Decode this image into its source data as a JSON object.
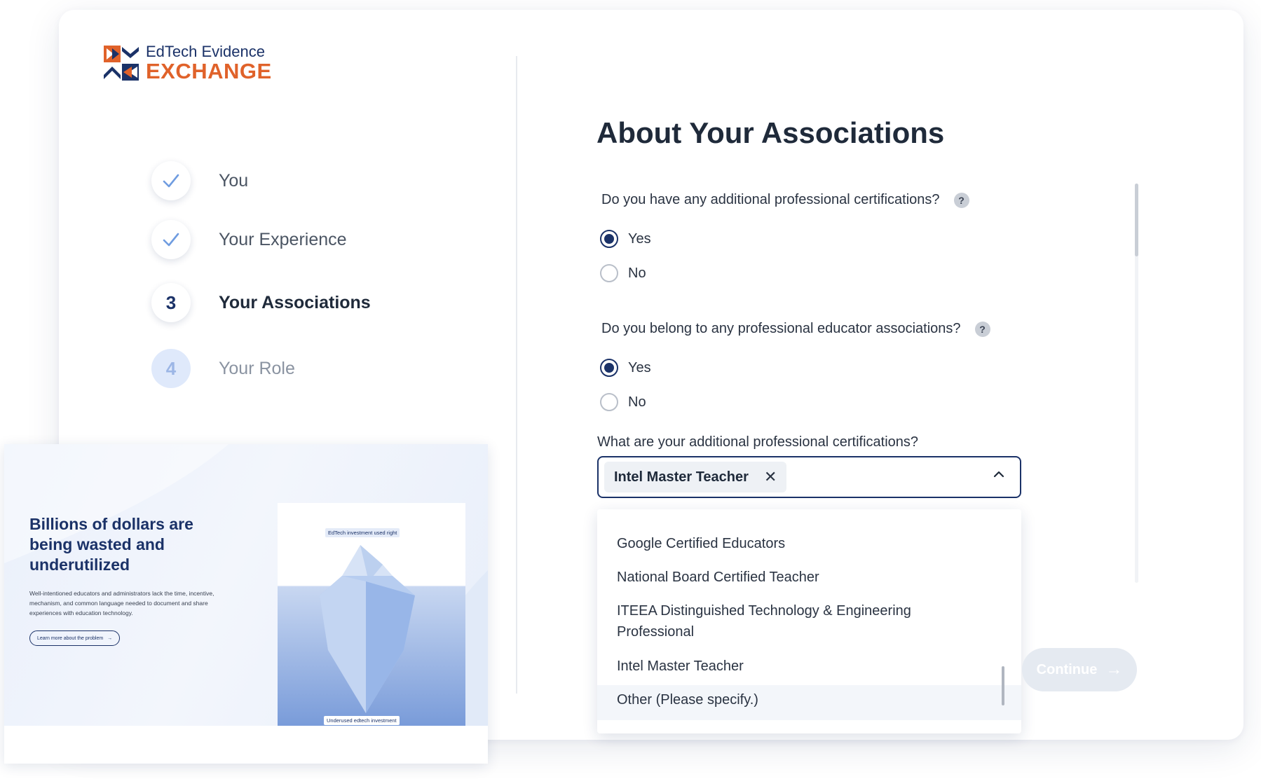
{
  "brand": {
    "line1": "EdTech Evidence",
    "line2": "EXCHANGE"
  },
  "steps": [
    {
      "number": "",
      "label": "You",
      "state": "done"
    },
    {
      "number": "",
      "label": "Your Experience",
      "state": "done"
    },
    {
      "number": "3",
      "label": "Your Associations",
      "state": "active"
    },
    {
      "number": "4",
      "label": "Your Role",
      "state": "future"
    }
  ],
  "form": {
    "title": "About Your Associations",
    "q1": {
      "text": "Do you have any additional professional certifications?",
      "help": "?",
      "options": [
        "Yes",
        "No"
      ],
      "selected": "Yes"
    },
    "q2": {
      "text": "Do you belong to any professional educator associations?",
      "help": "?",
      "options": [
        "Yes",
        "No"
      ],
      "selected": "Yes"
    },
    "certifications": {
      "label": "What are your additional professional certifications?",
      "selected_chip": "Intel Master Teacher",
      "chip_remove": "✕",
      "options": [
        "Google Certified Educators",
        "National Board Certified Teacher",
        "ITEEA Distinguished Technology & Engineering Professional",
        "Intel Master Teacher",
        "Other (Please specify.)"
      ],
      "highlighted": "Other (Please specify.)"
    },
    "continue_label": "Continue"
  },
  "promo": {
    "heading": "Billions of dollars are being wasted and underutilized",
    "body": "Well-intentioned educators and administrators lack the time, incentive, mechanism, and common language needed to document and share experiences with education technology.",
    "cta": "Learn more about the problem",
    "book_top_label": "EdTech investment used right",
    "book_bottom_label": "Underused edtech investment"
  },
  "colors": {
    "navy": "#1b3268",
    "orange": "#e0622a",
    "check": "#6f9ce0"
  }
}
